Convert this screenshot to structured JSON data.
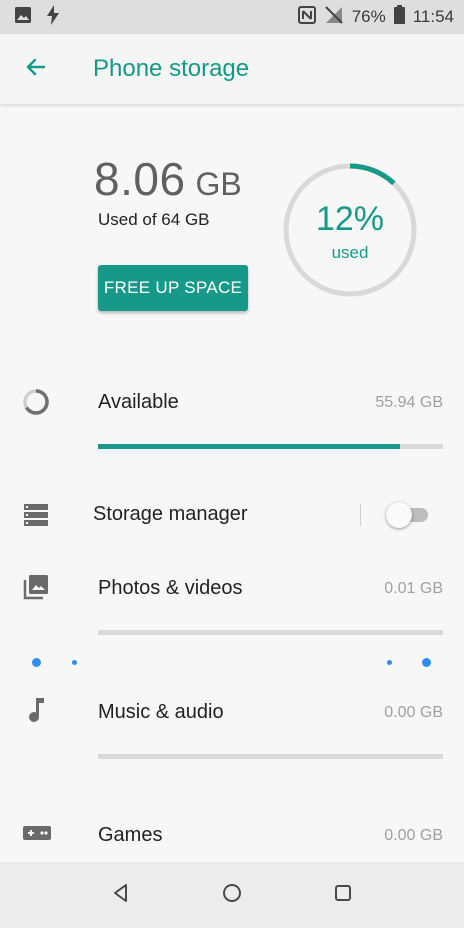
{
  "status_bar": {
    "battery": "76%",
    "time": "11:54",
    "icons": [
      "image-icon",
      "flash-icon",
      "nfc-icon",
      "no-signal-icon",
      "battery-icon"
    ]
  },
  "app_bar": {
    "title": "Phone storage",
    "back_icon": "arrow-left-icon"
  },
  "summary": {
    "used_value": "8.06",
    "used_unit": "GB",
    "used_of": "Used of 64 GB",
    "button_label": "FREE UP SPACE",
    "percent_label": "12%",
    "percent_sublabel": "used",
    "percent_used": 0.12,
    "accent_color": "#17998a"
  },
  "rows": {
    "available": {
      "label": "Available",
      "size": "55.94 GB",
      "fill_fraction": 0.874,
      "icon": "pie-progress-icon"
    },
    "storage_manager": {
      "label": "Storage manager",
      "toggle_on": false,
      "icon": "storage-list-icon"
    },
    "photos": {
      "label": "Photos & videos",
      "size": "0.01 GB",
      "fill_fraction": 0.0,
      "icon": "photo-library-icon"
    },
    "music": {
      "label": "Music & audio",
      "size": "0.00 GB",
      "fill_fraction": 0.0,
      "icon": "music-note-icon"
    },
    "games": {
      "label": "Games",
      "size": "0.00 GB",
      "icon": "gamepad-icon"
    }
  },
  "nav_bar": {
    "icons": [
      "back-triangle-icon",
      "home-circle-icon",
      "recents-square-icon"
    ]
  }
}
